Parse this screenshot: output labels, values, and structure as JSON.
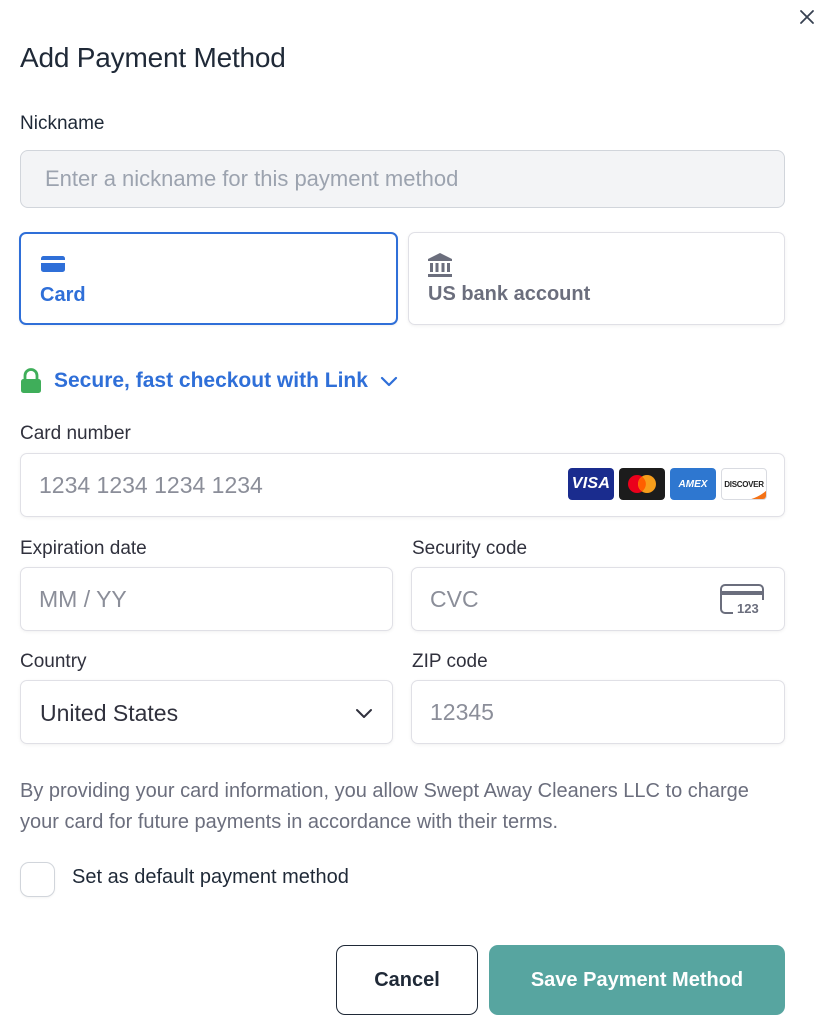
{
  "dialog": {
    "title": "Add Payment Method",
    "close_icon": "close-icon"
  },
  "nickname": {
    "label": "Nickname",
    "placeholder": "Enter a nickname for this payment method",
    "value": ""
  },
  "payment_tabs": [
    {
      "label": "Card",
      "icon": "credit-card-icon",
      "selected": true
    },
    {
      "label": "US bank account",
      "icon": "bank-icon",
      "selected": false
    }
  ],
  "link": {
    "text": "Secure, fast checkout with Link",
    "icon": "lock-icon"
  },
  "card_number": {
    "label": "Card number",
    "placeholder": "1234 1234 1234 1234",
    "brands": [
      "VISA",
      "mastercard",
      "AMEX",
      "DISCOVER"
    ]
  },
  "expiration": {
    "label": "Expiration date",
    "placeholder": "MM / YY"
  },
  "security_code": {
    "label": "Security code",
    "placeholder": "CVC",
    "icon_text": "123"
  },
  "country": {
    "label": "Country",
    "value": "United States"
  },
  "zip": {
    "label": "ZIP code",
    "placeholder": "12345"
  },
  "disclaimer": "By providing your card information, you allow Swept Away Cleaners LLC to charge your card for future payments in accordance with their terms.",
  "default_checkbox": {
    "label": "Set as default payment method",
    "checked": false
  },
  "buttons": {
    "cancel": "Cancel",
    "save": "Save Payment Method"
  },
  "colors": {
    "accent": "#2f6fd8",
    "save_button": "#57a5a0",
    "lock": "#3fae5a"
  }
}
